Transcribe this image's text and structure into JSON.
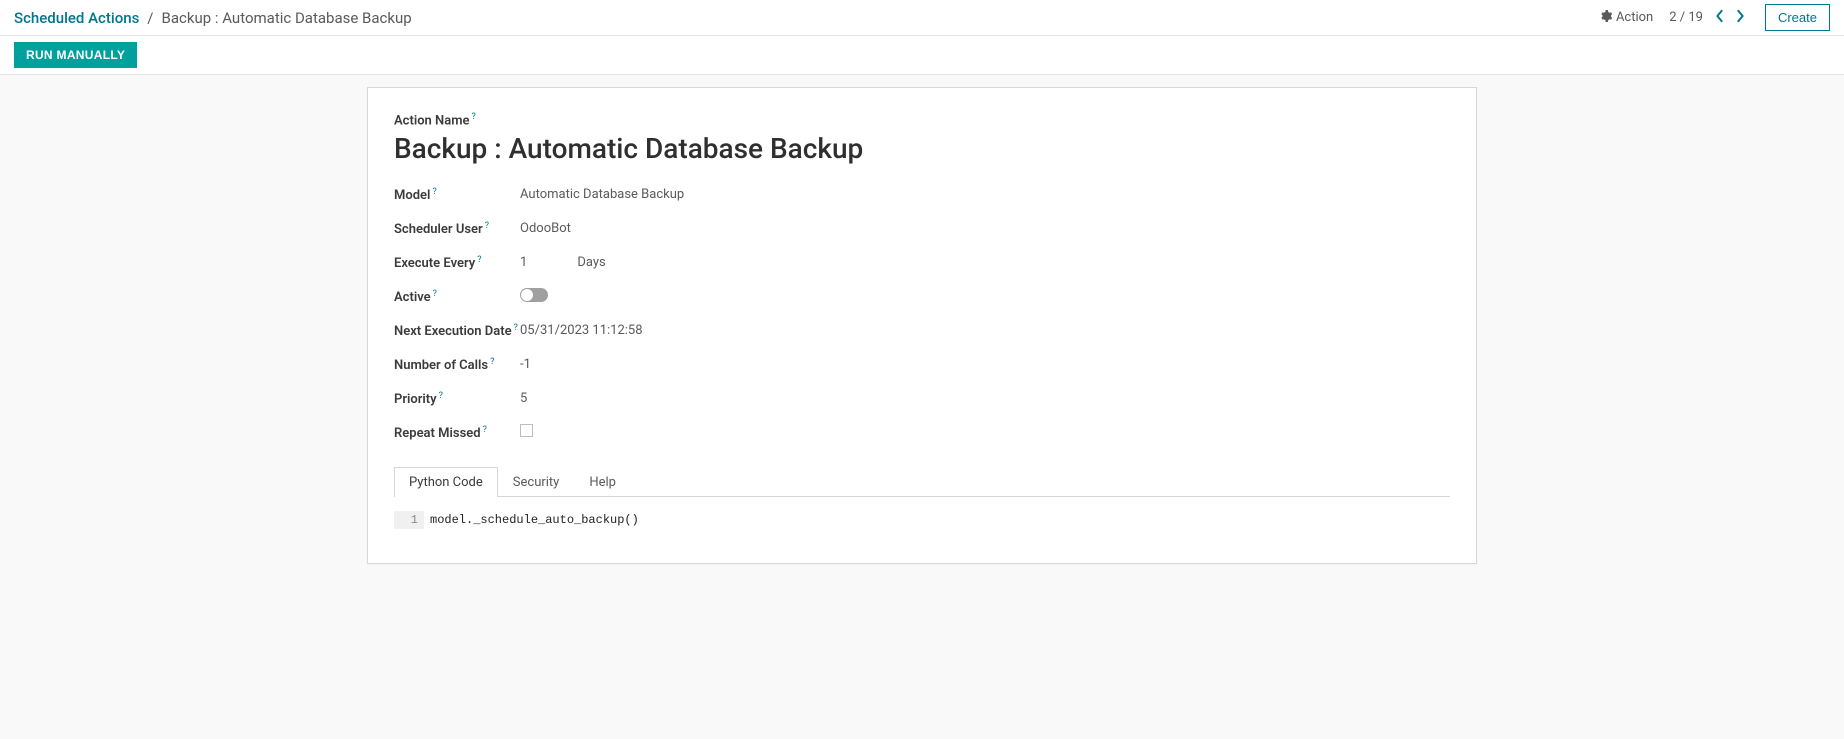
{
  "breadcrumb": {
    "root": "Scheduled Actions",
    "sep": "/",
    "current": "Backup : Automatic Database Backup"
  },
  "toolbar": {
    "action_label": "Action",
    "pager": "2 / 19",
    "create_label": "Create"
  },
  "buttons": {
    "run_manually": "RUN MANUALLY"
  },
  "form": {
    "action_name_label": "Action Name",
    "title": "Backup : Automatic Database Backup",
    "model_label": "Model",
    "model_value": "Automatic Database Backup",
    "user_label": "Scheduler User",
    "user_value": "OdooBot",
    "interval_label": "Execute Every",
    "interval_number": "1",
    "interval_unit": "Days",
    "active_label": "Active",
    "nextcall_label": "Next Execution Date",
    "nextcall_value": "05/31/2023 11:12:58",
    "numbercall_label": "Number of Calls",
    "numbercall_value": "-1",
    "priority_label": "Priority",
    "priority_value": "5",
    "doall_label": "Repeat Missed",
    "help_mark": "?"
  },
  "tabs": {
    "python": "Python Code",
    "security": "Security",
    "help": "Help"
  },
  "code": {
    "line_no": "1",
    "line_text": "model._schedule_auto_backup()"
  }
}
